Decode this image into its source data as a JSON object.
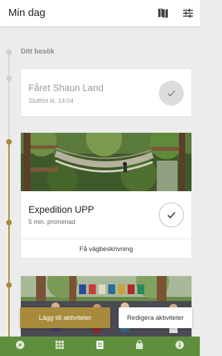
{
  "header": {
    "title": "Min dag"
  },
  "timeline": {
    "section_label": "Ditt besök"
  },
  "cards": [
    {
      "title": "Fåret Shaun Land",
      "subtitle": "Slutfört kl. 14:04",
      "completed": true
    },
    {
      "title": "Expedition UPP",
      "subtitle": "5 min. promenad",
      "completed": false,
      "action_label": "Få vägbeskrivning"
    },
    {
      "title": "",
      "subtitle": ""
    }
  ],
  "actions": {
    "add_label": "Lägg till aktiviteter",
    "edit_label": "Redigera aktiviteter"
  },
  "bottom_nav": {
    "items": [
      {
        "icon": "compass-icon",
        "label": ""
      },
      {
        "icon": "calendar-grid-icon",
        "label": ""
      },
      {
        "icon": "list-icon",
        "label": ""
      },
      {
        "icon": "bag-icon",
        "label": ""
      },
      {
        "icon": "info-icon",
        "label": ""
      }
    ]
  },
  "colors": {
    "accent_gold": "#a88a3c",
    "nav_green": "#5f8f3c",
    "timeline_grey": "#d6d6d6"
  }
}
